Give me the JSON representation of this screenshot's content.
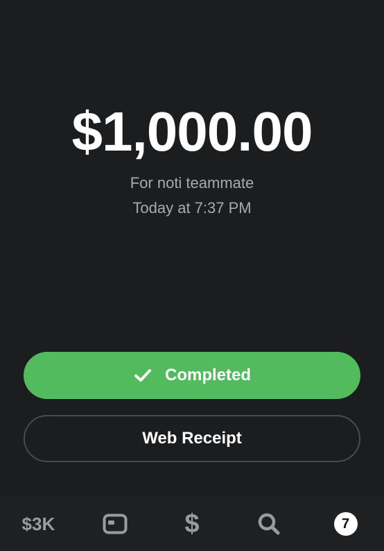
{
  "payment": {
    "amount": "$1,000.00",
    "note": "For noti teammate",
    "timestamp": "Today at 7:37 PM"
  },
  "actions": {
    "status_label": "Completed",
    "receipt_label": "Web Receipt"
  },
  "tabbar": {
    "balance_label": "$3K",
    "card_icon": "card-icon",
    "pay_label": "$",
    "search_icon": "search-icon",
    "activity_badge": "7"
  },
  "colors": {
    "background": "#1c1d1f",
    "accent_green": "#52bb5d",
    "muted_text": "#a9aaab"
  }
}
